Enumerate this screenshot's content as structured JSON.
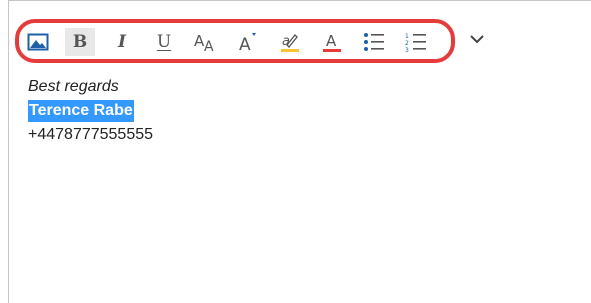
{
  "toolbar": {
    "buttons": [
      {
        "name": "insert-image-button",
        "icon": "image-icon"
      },
      {
        "name": "bold-button",
        "icon": "bold-icon",
        "label": "B"
      },
      {
        "name": "italic-button",
        "icon": "italic-icon",
        "label": "I"
      },
      {
        "name": "underline-button",
        "icon": "underline-icon",
        "label": "U"
      },
      {
        "name": "font-size-button",
        "icon": "font-size-icon"
      },
      {
        "name": "grow-font-button",
        "icon": "grow-font-icon"
      },
      {
        "name": "highlight-button",
        "icon": "highlighter-icon"
      },
      {
        "name": "font-color-button",
        "icon": "font-color-icon",
        "label": "A"
      },
      {
        "name": "bullets-button",
        "icon": "bulleted-list-icon"
      },
      {
        "name": "numbering-button",
        "icon": "numbered-list-icon"
      }
    ],
    "more_icon": "chevron-down-icon",
    "accent_highlight": "#f7c531",
    "accent_font_color": "#e53b3b",
    "annotation_color": "#e53b3b"
  },
  "body": {
    "line1": "Best regards",
    "line2": "Terence Rabe",
    "line3": "+4478777555555"
  },
  "selection_color": "#3399ff"
}
